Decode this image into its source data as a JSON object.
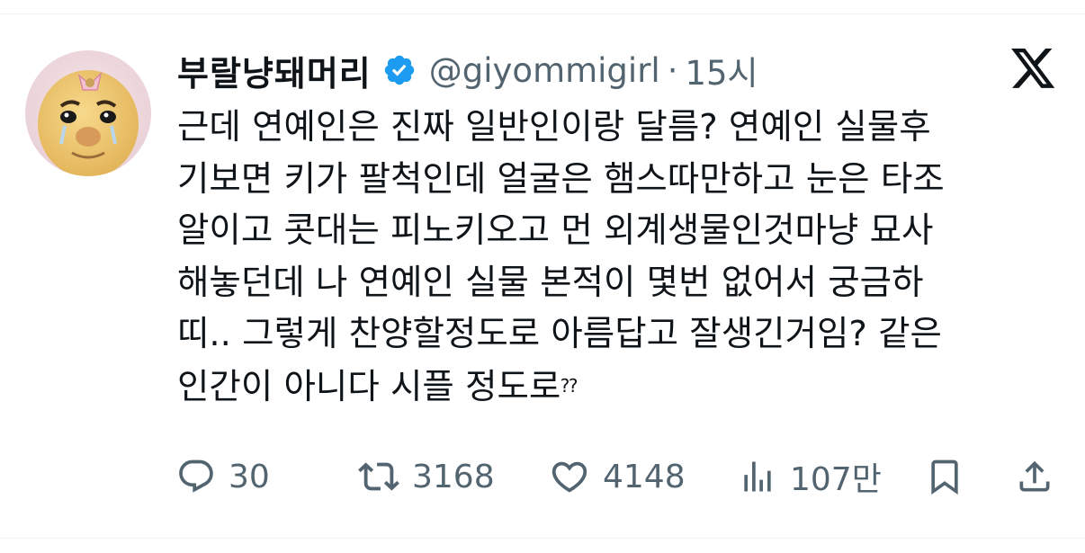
{
  "author": {
    "display_name": "부랄냥돼머리",
    "handle": "@giyommigirl",
    "separator": "·",
    "time": "15시",
    "verified": true
  },
  "tweet": {
    "lines": [
      "근데 연예인은 진짜 일반인이랑 달름? 연예인 실물후",
      "기보면 키가 팔척인데 얼굴은 햄스따만하고 눈은 타조",
      "알이고 콧대는 피노키오고 먼 외계생물인것마냥 묘사",
      "해놓던데 나 연예인 실물 본적이 몇번 없어서 궁금하",
      "띠.. 그렇게 찬양할정도로 아름답고 잘생긴거임? 같은",
      "인간이 아니다 시플 정도로"
    ],
    "trailing_marks": "⁇"
  },
  "actions": {
    "replies": "30",
    "retweets": "3168",
    "likes": "4148",
    "views": "107만"
  },
  "colors": {
    "text_primary": "#0f1419",
    "text_secondary": "#536471",
    "verified_badge": "#1d9bf0",
    "divider": "#eff3f4"
  },
  "icons": {
    "reply": "reply-icon",
    "retweet": "retweet-icon",
    "like": "like-icon",
    "views": "views-icon",
    "bookmark": "bookmark-icon",
    "share": "share-icon",
    "platform_logo": "x-logo-icon"
  }
}
